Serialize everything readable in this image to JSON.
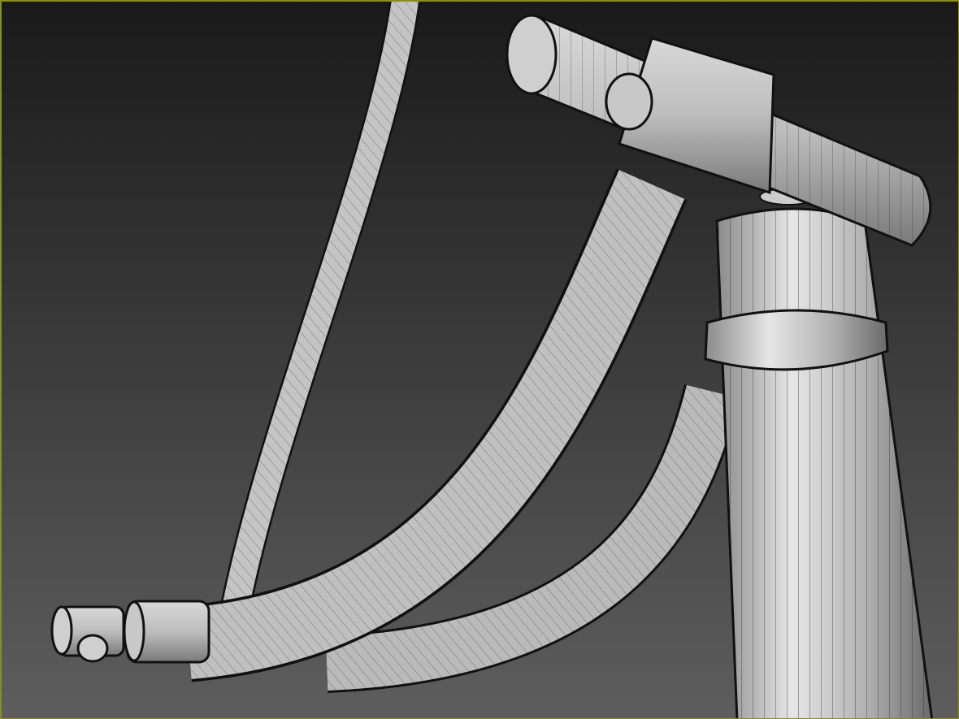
{
  "viewport": {
    "border_color": "#8c8c1e",
    "background_top": "#1a1a1a",
    "background_bottom": "#5e5e5e",
    "mesh_fill": "#b8b8b8",
    "wire_color": "#1e1e1e"
  }
}
